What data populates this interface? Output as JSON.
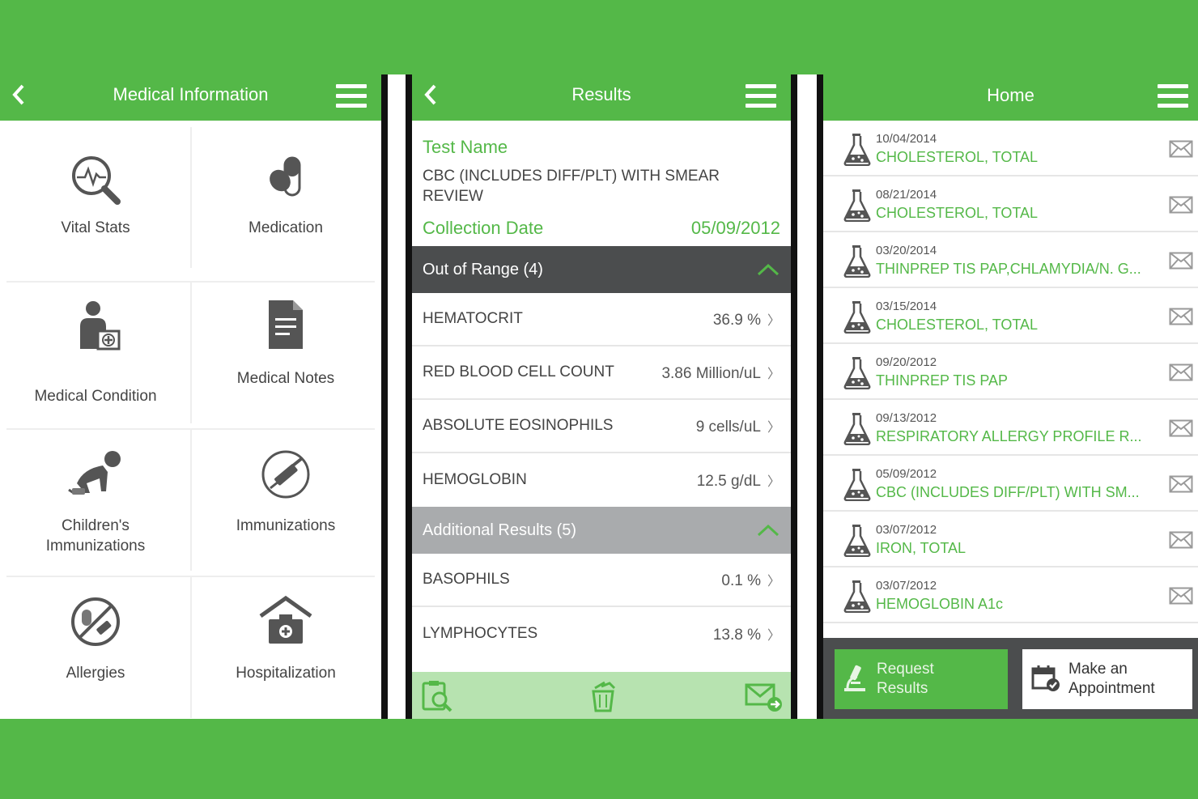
{
  "colors": {
    "brand_green": "#54b848",
    "dark_header": "#4b4d4e",
    "grey_header": "#a9abad",
    "toolbar_green": "#b7e3b0"
  },
  "screen1": {
    "title": "Medical Information",
    "back_icon": "chevron-left-icon",
    "menu_icon": "hamburger-menu-icon",
    "tiles": [
      {
        "label": "Vital Stats",
        "icon": "magnifier-heartbeat-icon"
      },
      {
        "label": "Medication",
        "icon": "pills-icon"
      },
      {
        "label": "Medical Condition",
        "icon": "person-medkit-icon"
      },
      {
        "label": "Medical Notes",
        "icon": "document-icon"
      },
      {
        "label": "Children's Immunizations",
        "icon": "crawling-baby-icon"
      },
      {
        "label": "Immunizations",
        "icon": "syringe-icon"
      },
      {
        "label": "Allergies",
        "icon": "no-pills-icon"
      },
      {
        "label": "Hospitalization",
        "icon": "hospital-icon"
      }
    ],
    "tile_label_lines": {
      "childrens": [
        "Children's",
        "Immunizations"
      ]
    }
  },
  "screen2": {
    "title": "Results",
    "test_name_label": "Test Name",
    "test_name": "CBC (INCLUDES DIFF/PLT) WITH SMEAR REVIEW",
    "collection_date_label": "Collection Date",
    "collection_date": "05/09/2012",
    "out_of_range": {
      "label": "Out of Range (4)",
      "rows": [
        {
          "name": "HEMATOCRIT",
          "value": "36.9 %"
        },
        {
          "name": "RED BLOOD CELL COUNT",
          "value": "3.86 Million/uL"
        },
        {
          "name": "ABSOLUTE EOSINOPHILS",
          "value": "9 cells/uL"
        },
        {
          "name": "HEMOGLOBIN",
          "value": "12.5 g/dL"
        }
      ]
    },
    "additional": {
      "label": "Additional Results (5)",
      "rows": [
        {
          "name": "BASOPHILS",
          "value": "0.1 %"
        },
        {
          "name": "LYMPHOCYTES",
          "value": "13.8 %"
        }
      ]
    },
    "chevron": "〉",
    "toolbar_icons": [
      "clipboard-search-icon",
      "trash-icon",
      "email-send-icon"
    ]
  },
  "screen3": {
    "title": "Home",
    "items": [
      {
        "date": "10/04/2014",
        "name": "CHOLESTEROL, TOTAL"
      },
      {
        "date": "08/21/2014",
        "name": "CHOLESTEROL, TOTAL"
      },
      {
        "date": "03/20/2014",
        "name": "THINPREP TIS PAP,CHLAMYDIA/N. G..."
      },
      {
        "date": "03/15/2014",
        "name": "CHOLESTEROL, TOTAL"
      },
      {
        "date": "09/20/2012",
        "name": "THINPREP TIS PAP"
      },
      {
        "date": "09/13/2012",
        "name": "RESPIRATORY ALLERGY PROFILE R..."
      },
      {
        "date": "05/09/2012",
        "name": "CBC (INCLUDES DIFF/PLT) WITH SM..."
      },
      {
        "date": "03/07/2012",
        "name": "IRON, TOTAL"
      },
      {
        "date": "03/07/2012",
        "name": "HEMOGLOBIN A1c"
      }
    ],
    "request_button": {
      "line1": "Request",
      "line2": "Results"
    },
    "appointment_button": {
      "line1": "Make an",
      "line2": "Appointment"
    }
  }
}
